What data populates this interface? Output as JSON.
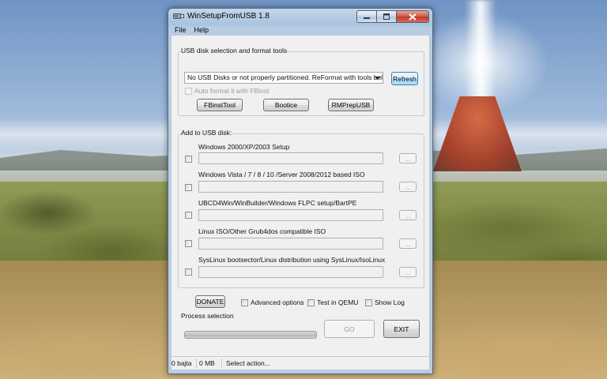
{
  "window": {
    "title": "WinSetupFromUSB 1.8",
    "app_icon": "usb-drive-icon"
  },
  "menu": {
    "file": "File",
    "help": "Help"
  },
  "usb_disk_group": {
    "label": "USB disk selection and format tools",
    "disk_select_value": "No USB Disks or not properly partitioned. ReFormat with tools below",
    "refresh_label": "Refresh",
    "auto_format_label": "Auto format it with FBinst",
    "auto_format_checked": false,
    "tools": [
      "FBinstTool",
      "Bootice",
      "RMPrepUSB"
    ]
  },
  "add_group": {
    "label": "Add to USB disk:",
    "sources": [
      {
        "label": "Windows 2000/XP/2003 Setup",
        "path": "",
        "browse": "..."
      },
      {
        "label": "Windows Vista / 7 / 8 / 10 /Server 2008/2012 based ISO",
        "path": "",
        "browse": "..."
      },
      {
        "label": "UBCD4Win/WinBuilder/Windows FLPC setup/BartPE",
        "path": "",
        "browse": "..."
      },
      {
        "label": "Linux ISO/Other Grub4dos compatible ISO",
        "path": "",
        "browse": "..."
      },
      {
        "label": "SysLinux bootsector/Linux distribution using SysLinux/IsoLinux",
        "path": "",
        "browse": "..."
      }
    ]
  },
  "options": {
    "donate_label": "DONATE",
    "advanced_label": "Advanced options",
    "qemu_label": "Test in QEMU",
    "showlog_label": "Show Log"
  },
  "process": {
    "label": "Process selection",
    "progress": 0,
    "go_label": "GO",
    "exit_label": "EXIT"
  },
  "status": {
    "bytes": "0 bajta",
    "size": "0 MB",
    "message": "Select action..."
  },
  "colors": {
    "accent": "#3c7fb1",
    "close_button": "#c13a2a"
  }
}
